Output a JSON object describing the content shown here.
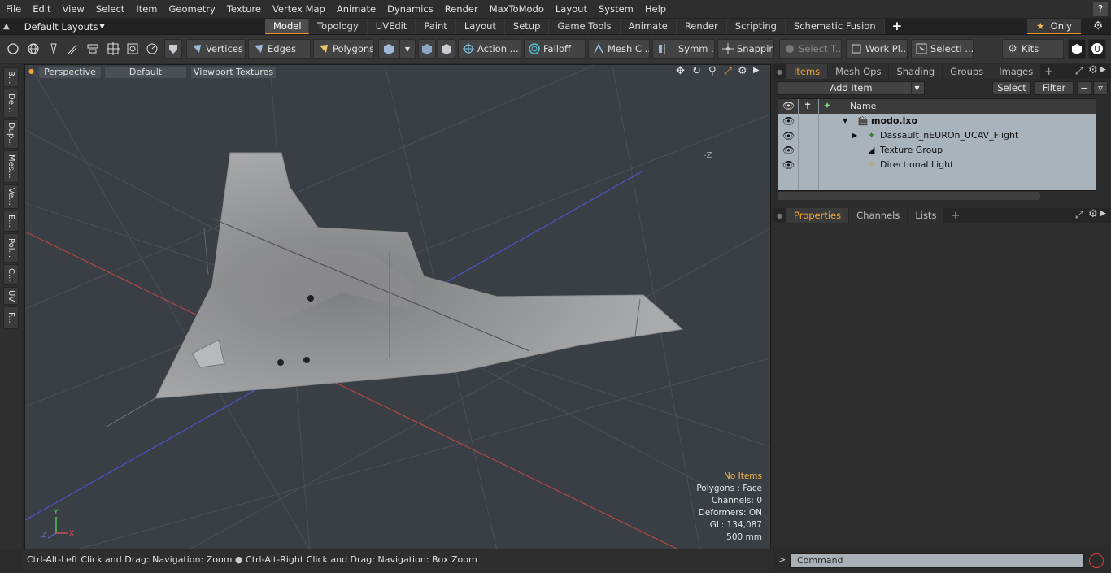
{
  "menu": [
    "File",
    "Edit",
    "View",
    "Select",
    "Item",
    "Geometry",
    "Texture",
    "Vertex Map",
    "Animate",
    "Dynamics",
    "Render",
    "MaxToModo",
    "Layout",
    "System",
    "Help"
  ],
  "layout_selector": "Default Layouts",
  "mode_tabs": [
    "Model",
    "Topology",
    "UVEdit",
    "Paint",
    "Layout",
    "Setup",
    "Game Tools",
    "Animate",
    "Render",
    "Scripting",
    "Schematic Fusion"
  ],
  "active_tab": "Model",
  "only_button": "Only",
  "toolbar": {
    "vertices": "Vertices",
    "edges": "Edges",
    "polygons": "Polygons",
    "action": "Action ...",
    "falloff": "Falloff",
    "mesh": "Mesh C ...",
    "symm": "Symm ...",
    "snapping": "Snapping",
    "select_t": "Select T...",
    "work_pl": "Work Pl...",
    "selecti": "Selecti ...",
    "kits": "Kits"
  },
  "left_tools": [
    "B...",
    "De...",
    "Dup...",
    "Mes...",
    "Ve...",
    "E...",
    "Pol...",
    "C...",
    "UV",
    "F..."
  ],
  "viewport": {
    "view": "Perspective",
    "shading": "Default",
    "textures": "Viewport Textures",
    "axis_label": "-Z",
    "stats": {
      "items": "No Items",
      "polygons": "Polygons : Face",
      "channels": "Channels: 0",
      "deformers": "Deformers: ON",
      "gl": "GL: 134,087",
      "scale": "500 mm"
    },
    "gizmo": {
      "x": "X",
      "y": "Y",
      "z": "Z"
    }
  },
  "status_bar": {
    "hint1": "Ctrl-Alt-Left Click and Drag: Navigation: Zoom",
    "hint2": "Ctrl-Alt-Right Click and Drag: Navigation: Box Zoom"
  },
  "items_panel": {
    "tabs": [
      "Items",
      "Mesh Ops",
      "Shading",
      "Groups",
      "Images"
    ],
    "active": "Items",
    "add_item": "Add Item",
    "select": "Select",
    "filter": "Filter",
    "column_name": "Name",
    "rows": [
      {
        "label": "modo.lxo",
        "icon": "scene-icon"
      },
      {
        "label": "Dassault_nEUROn_UCAV_Flight",
        "icon": "mesh-icon"
      },
      {
        "label": "Texture Group",
        "icon": "texture-icon"
      },
      {
        "label": "Directional Light",
        "icon": "light-icon"
      }
    ]
  },
  "properties_panel": {
    "tabs": [
      "Properties",
      "Channels",
      "Lists"
    ],
    "active": "Properties"
  },
  "command": {
    "placeholder": "Command",
    "prompt": ">"
  },
  "colors": {
    "accent": "#e8952c",
    "items_bg": "#a9b3bc",
    "viewport_bg": "#3a3e45"
  }
}
